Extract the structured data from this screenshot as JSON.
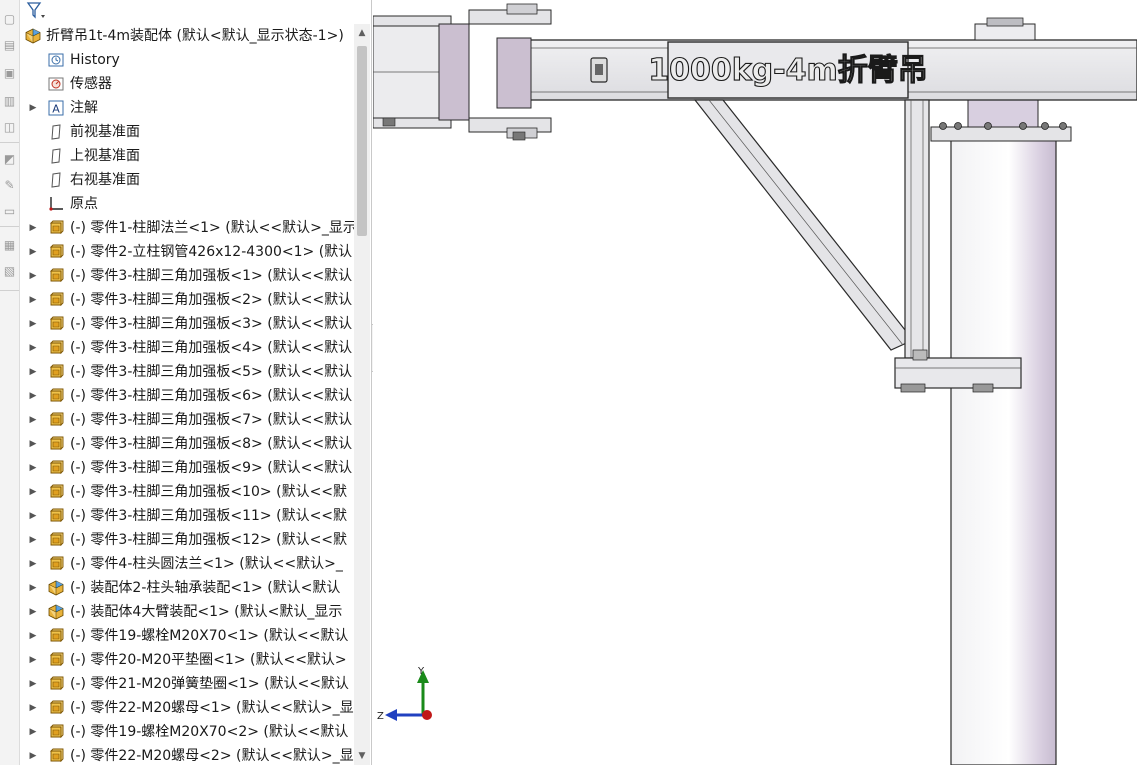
{
  "tree": {
    "root": {
      "label": "折臂吊1t-4m装配体 (默认<默认_显示状态-1>)",
      "icon": "assembly-icon"
    },
    "items": [
      {
        "label": "History",
        "icon": "history-icon",
        "expandable": false
      },
      {
        "label": "传感器",
        "icon": "sensor-icon",
        "expandable": false
      },
      {
        "label": "注解",
        "icon": "annotation-icon",
        "expandable": true
      },
      {
        "label": "前视基准面",
        "icon": "plane-icon",
        "expandable": false
      },
      {
        "label": "上视基准面",
        "icon": "plane-icon",
        "expandable": false
      },
      {
        "label": "右视基准面",
        "icon": "plane-icon",
        "expandable": false
      },
      {
        "label": "原点",
        "icon": "origin-icon",
        "expandable": false
      },
      {
        "label": "(-) 零件1-柱脚法兰<1> (默认<<默认>_显示",
        "icon": "part-icon",
        "expandable": true
      },
      {
        "label": "(-) 零件2-立柱钢管426x12-4300<1> (默认",
        "icon": "part-icon",
        "expandable": true
      },
      {
        "label": "(-) 零件3-柱脚三角加强板<1> (默认<<默认",
        "icon": "part-icon",
        "expandable": true
      },
      {
        "label": "(-) 零件3-柱脚三角加强板<2> (默认<<默认",
        "icon": "part-icon",
        "expandable": true
      },
      {
        "label": "(-) 零件3-柱脚三角加强板<3> (默认<<默认",
        "icon": "part-icon",
        "expandable": true
      },
      {
        "label": "(-) 零件3-柱脚三角加强板<4> (默认<<默认",
        "icon": "part-icon",
        "expandable": true
      },
      {
        "label": "(-) 零件3-柱脚三角加强板<5> (默认<<默认",
        "icon": "part-icon",
        "expandable": true
      },
      {
        "label": "(-) 零件3-柱脚三角加强板<6> (默认<<默认",
        "icon": "part-icon",
        "expandable": true
      },
      {
        "label": "(-) 零件3-柱脚三角加强板<7> (默认<<默认",
        "icon": "part-icon",
        "expandable": true
      },
      {
        "label": "(-) 零件3-柱脚三角加强板<8> (默认<<默认",
        "icon": "part-icon",
        "expandable": true
      },
      {
        "label": "(-) 零件3-柱脚三角加强板<9> (默认<<默认",
        "icon": "part-icon",
        "expandable": true
      },
      {
        "label": "(-) 零件3-柱脚三角加强板<10> (默认<<默",
        "icon": "part-icon",
        "expandable": true
      },
      {
        "label": "(-) 零件3-柱脚三角加强板<11> (默认<<默",
        "icon": "part-icon",
        "expandable": true
      },
      {
        "label": "(-) 零件3-柱脚三角加强板<12> (默认<<默",
        "icon": "part-icon",
        "expandable": true
      },
      {
        "label": "(-) 零件4-柱头圆法兰<1> (默认<<默认>_",
        "icon": "part-icon",
        "expandable": true
      },
      {
        "label": "(-) 装配体2-柱头轴承装配<1> (默认<默认",
        "icon": "subassembly-icon",
        "expandable": true
      },
      {
        "label": "(-) 装配体4大臂装配<1> (默认<默认_显示",
        "icon": "subassembly-icon",
        "expandable": true
      },
      {
        "label": "(-) 零件19-螺栓M20X70<1> (默认<<默认",
        "icon": "part-icon",
        "expandable": true
      },
      {
        "label": "(-) 零件20-M20平垫圈<1> (默认<<默认>",
        "icon": "part-icon",
        "expandable": true
      },
      {
        "label": "(-) 零件21-M20弹簧垫圈<1> (默认<<默认",
        "icon": "part-icon",
        "expandable": true
      },
      {
        "label": "(-) 零件22-M20螺母<1> (默认<<默认>_显",
        "icon": "part-icon",
        "expandable": true
      },
      {
        "label": "(-) 零件19-螺栓M20X70<2> (默认<<默认",
        "icon": "part-icon",
        "expandable": true
      },
      {
        "label": "(-) 零件22-M20螺母<2> (默认<<默认>_显",
        "icon": "part-icon",
        "expandable": true
      }
    ]
  },
  "viewport": {
    "nameplate": "1000kg-4m折臂吊",
    "triad": {
      "y_label": "Y",
      "z_label": "Z"
    }
  },
  "colors": {
    "steel": "#e6e6e9",
    "steel_dark": "#cfcfd4",
    "mauve": "#cbbfd0",
    "edge": "#2a2a2a",
    "part_icon": "#e8b23a",
    "triad_y": "#1a8a1a",
    "triad_z": "#2040c0",
    "triad_x": "#c01818"
  },
  "left_strip_icons": [
    "view-icon",
    "display-icon",
    "appearance-icon",
    "scene-icon",
    "section-icon",
    "measure-icon",
    "sketch-icon",
    "layout-icon",
    "tools-icon",
    "misc-icon"
  ]
}
